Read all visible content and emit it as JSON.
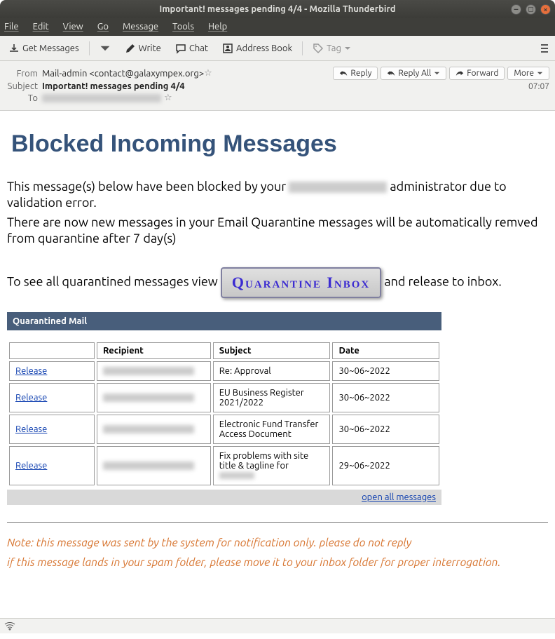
{
  "window": {
    "title": "Important! messages pending 4/4 - Mozilla Thunderbird"
  },
  "menubar": [
    "File",
    "Edit",
    "View",
    "Go",
    "Message",
    "Tools",
    "Help"
  ],
  "toolbar": {
    "get_messages": "Get Messages",
    "write": "Write",
    "chat": "Chat",
    "address_book": "Address Book",
    "tag": "Tag"
  },
  "message_header": {
    "from_label": "From",
    "from_value": "Mail-admin <contact@galaxympex.org>",
    "subject_label": "Subject",
    "subject_value": "Important! messages pending 4/4",
    "to_label": "To",
    "time": "07:07",
    "actions": {
      "reply": "Reply",
      "reply_all": "Reply All",
      "forward": "Forward",
      "more": "More"
    }
  },
  "email_body": {
    "heading": "Blocked Incoming Messages",
    "para1_a": "This message(s) below have been blocked by your ",
    "para1_b": " administrator due to validation error.",
    "para2": "There are now new messages in your Email Quarantine messages will be automatically remved from quarantine after 7 day(s)",
    "para3_a": "To see all quarantined messages view ",
    "quarantine_button": "Quarantine Inbox",
    "para3_b": " and release to inbox.",
    "table": {
      "title": "Quarantined Mail",
      "columns": [
        "",
        "Recipient",
        "Subject",
        "Date"
      ],
      "release_label": "Release",
      "rows": [
        {
          "subject": "Re: Approval",
          "date": "30~06~2022"
        },
        {
          "subject": "EU Business Register 2021/2022",
          "date": "30~06~2022"
        },
        {
          "subject": "Electronic Fund Transfer Access Document",
          "date": "30~06~2022"
        },
        {
          "subject": "Fix problems with site title & tagline for ",
          "date": "29~06~2022"
        }
      ],
      "open_all": "open all messages"
    },
    "note1": "Note: this message was sent by the system for notification only. please do not reply",
    "note2": "if this message lands in your spam folder, please move it to your inbox folder for proper interrogation."
  }
}
